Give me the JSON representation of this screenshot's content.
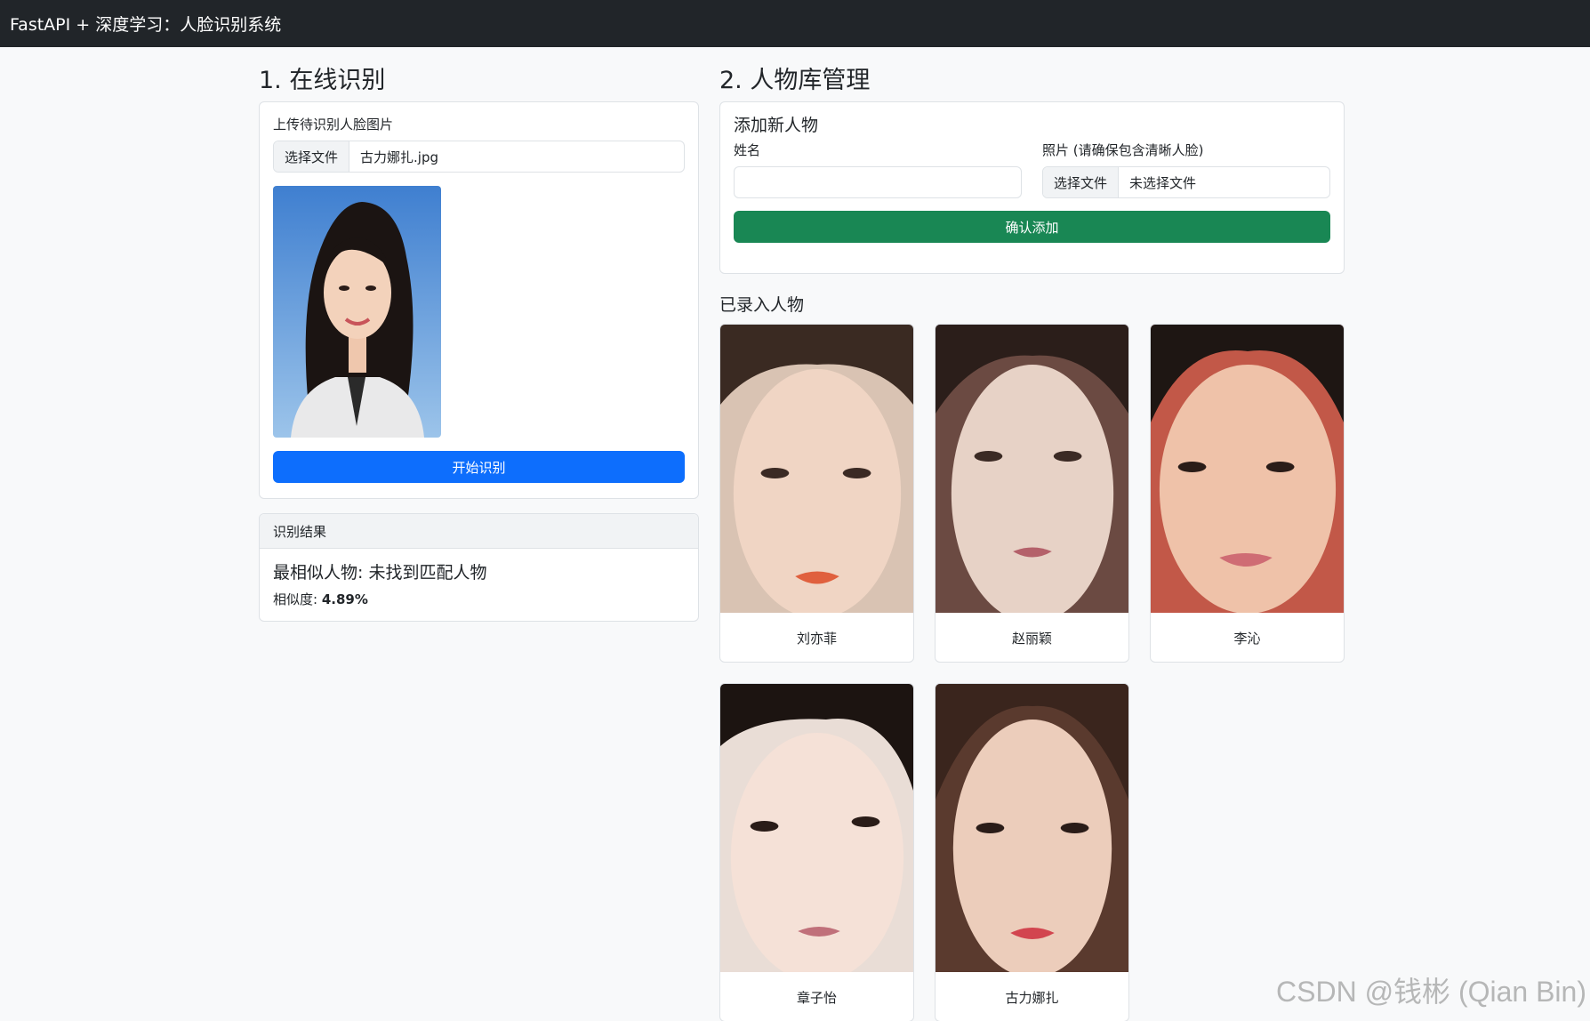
{
  "navbar": {
    "brand": "FastAPI + 深度学习：人脸识别系统"
  },
  "recognize": {
    "title": "1. 在线识别",
    "upload_label": "上传待识别人脸图片",
    "file_button": "选择文件",
    "file_name": "古力娜扎.jpg",
    "start_button": "开始识别",
    "result_header": "识别结果",
    "result_text": "最相似人物: 未找到匹配人物",
    "similarity_label": "相似度: ",
    "similarity_value": "4.89%"
  },
  "library": {
    "title": "2. 人物库管理",
    "add_title": "添加新人物",
    "name_label": "姓名",
    "name_value": "",
    "photo_label": "照片 (请确保包含清晰人脸)",
    "photo_button": "选择文件",
    "photo_file": "未选择文件",
    "confirm_button": "确认添加",
    "gallery_title": "已录入人物",
    "people": [
      {
        "name": "刘亦菲"
      },
      {
        "name": "赵丽颖"
      },
      {
        "name": "李沁"
      },
      {
        "name": "章子怡"
      },
      {
        "name": "古力娜扎"
      }
    ]
  },
  "watermark": "CSDN @钱彬 (Qian Bin)",
  "colors": {
    "navbar": "#212529",
    "primary": "#0d6efd",
    "success": "#198754",
    "background": "#f8f9fa"
  }
}
